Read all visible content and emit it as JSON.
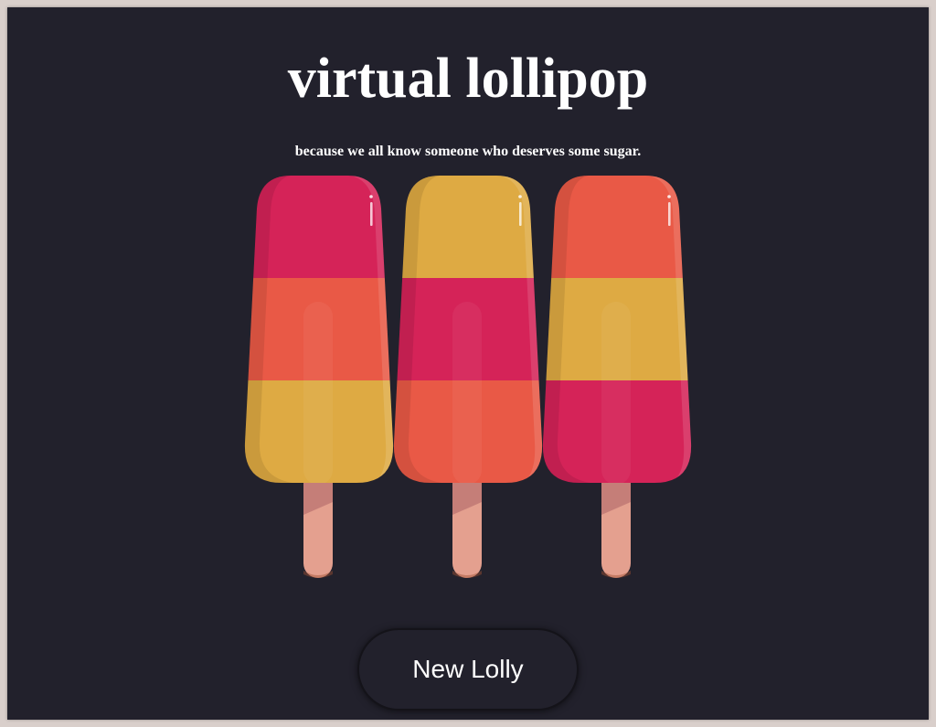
{
  "page": {
    "title": "virtual lollipop",
    "subtitle": "because we all know someone who deserves some sugar."
  },
  "lollies": [
    {
      "top": "#d52358",
      "middle": "#e95946",
      "bottom": "#deaa43"
    },
    {
      "top": "#deaa43",
      "middle": "#d52358",
      "bottom": "#e95946"
    },
    {
      "top": "#e95946",
      "middle": "#deaa43",
      "bottom": "#d52358"
    }
  ],
  "stick_color": "#e4a08f",
  "button": {
    "label": "New Lolly"
  }
}
